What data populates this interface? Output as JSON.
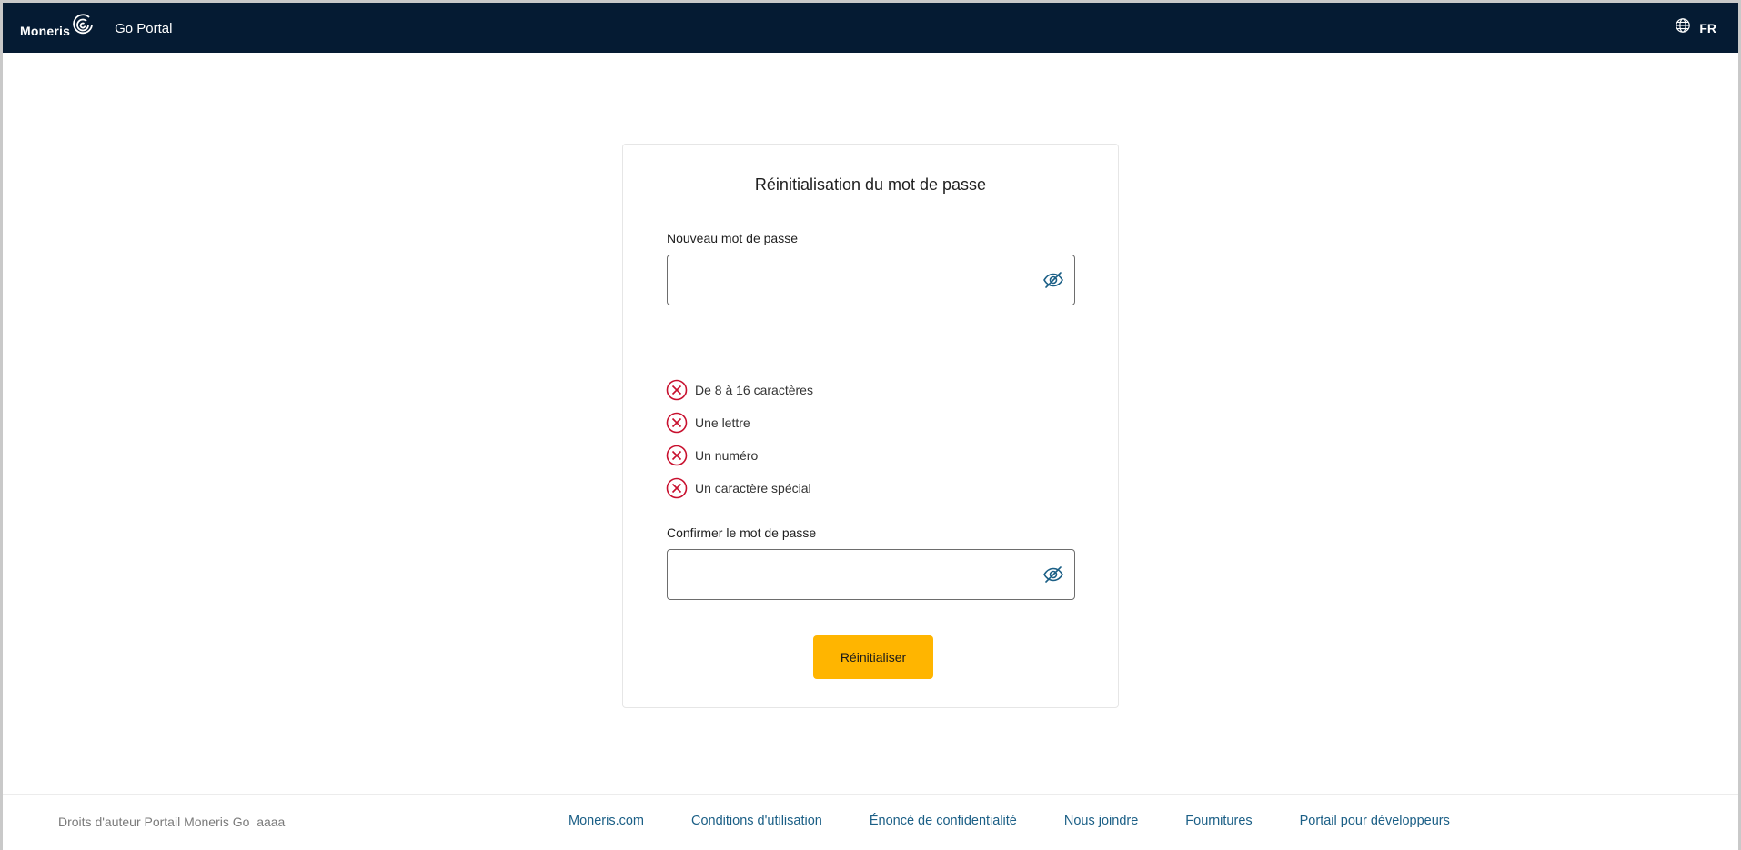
{
  "header": {
    "logo_text": "Moneris",
    "product_name": "Go Portal",
    "language_label": "FR",
    "icons": {
      "logo": "moneris-swirl-logo",
      "language": "globe-icon"
    }
  },
  "form": {
    "title": "Réinitialisation du mot de passe",
    "new_password_label": "Nouveau mot de passe",
    "new_password_value": "",
    "confirm_password_label": "Confirmer le mot de passe",
    "confirm_password_value": "",
    "toggle_icon": "eye-slash-icon",
    "requirements": [
      {
        "text": "De 8 à 16 caractères",
        "status": "unmet",
        "icon": "x-circle-icon"
      },
      {
        "text": "Une lettre",
        "status": "unmet",
        "icon": "x-circle-icon"
      },
      {
        "text": "Un numéro",
        "status": "unmet",
        "icon": "x-circle-icon"
      },
      {
        "text": "Un caractère spécial",
        "status": "unmet",
        "icon": "x-circle-icon"
      }
    ],
    "submit_label": "Réinitialiser"
  },
  "footer": {
    "copyright": "Droits d'auteur Portail Moneris Go  aaaa",
    "links": [
      "Moneris.com",
      "Conditions d'utilisation",
      "Énoncé de confidentialité",
      "Nous joindre",
      "Fournitures",
      "Portail pour développeurs"
    ]
  },
  "colors": {
    "header_bg": "#051b33",
    "accent_button": "#ffb500",
    "error_red": "#c8102e",
    "icon_teal": "#1b5f86",
    "link_blue": "#1b5f86"
  }
}
